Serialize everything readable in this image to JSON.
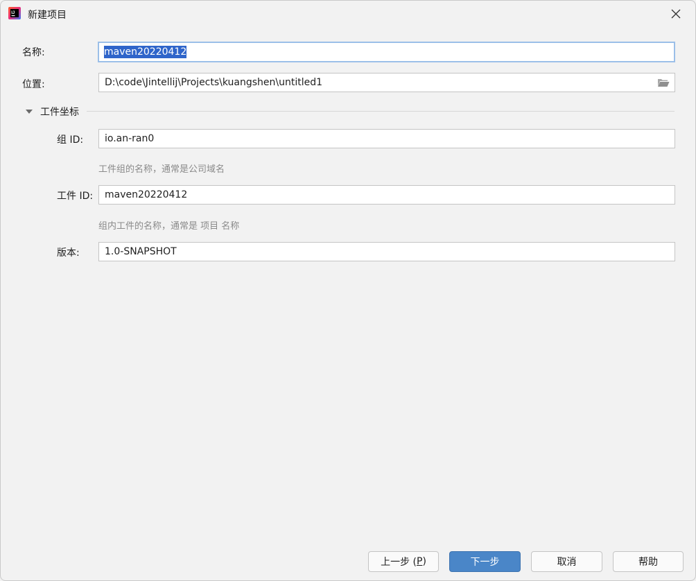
{
  "window": {
    "title": "新建项目"
  },
  "form": {
    "name_label": "名称:",
    "name_value": "maven20220412",
    "location_label": "位置:",
    "location_value": "D:\\code\\Jintellij\\Projects\\kuangshen\\untitled1",
    "section_label": "工件坐标",
    "group_label": "组 ID:",
    "group_value": "io.an-ran0",
    "group_hint": "工件组的名称，通常是公司域名",
    "artifact_label": "工件 ID:",
    "artifact_value": "maven20220412",
    "artifact_hint": "组内工件的名称，通常是 项目 名称",
    "version_label": "版本:",
    "version_value": "1.0-SNAPSHOT"
  },
  "buttons": {
    "previous_prefix": "上一步 (",
    "previous_mnemonic": "P",
    "previous_suffix": ")",
    "next": "下一步",
    "cancel": "取消",
    "help": "帮助"
  },
  "colors": {
    "accent": "#4a86c8",
    "selection": "#2f65ca",
    "focus_border": "#9bbfe8",
    "background": "#f2f2f2"
  },
  "icons": {
    "app": "intellij-idea-icon",
    "close": "close-icon",
    "folder": "folder-open-icon",
    "section_toggle": "triangle-down-icon"
  }
}
